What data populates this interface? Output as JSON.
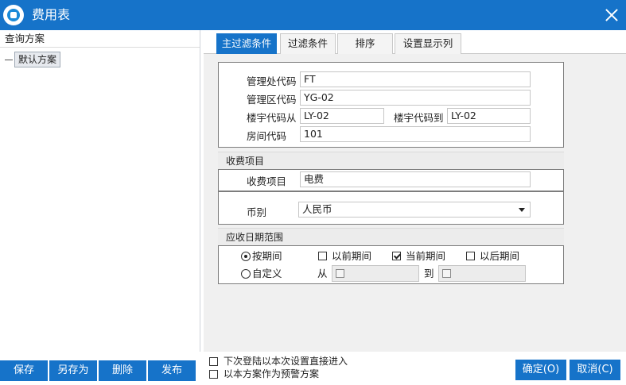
{
  "window": {
    "title": "费用表",
    "logo_icon": "app-logo-icon",
    "close_icon": "close-icon"
  },
  "left_panel": {
    "header": "查询方案",
    "schemes": [
      {
        "label": "默认方案",
        "selected": true
      }
    ]
  },
  "tabs": [
    {
      "label": "主过滤条件",
      "active": true
    },
    {
      "label": "过滤条件",
      "active": false
    },
    {
      "label": "排序",
      "active": false
    },
    {
      "label": "设置显示列",
      "active": false
    }
  ],
  "main_filter": {
    "mgmt_office_code": {
      "label": "管理处代码",
      "value": "FT"
    },
    "mgmt_area_code": {
      "label": "管理区代码",
      "value": "YG-02"
    },
    "building_from": {
      "label": "楼宇代码从",
      "value": "LY-02"
    },
    "building_to": {
      "label": "楼宇代码到",
      "value": "LY-02"
    },
    "room_code": {
      "label": "房间代码",
      "value": "101"
    }
  },
  "charge_section": {
    "header": "收费项目",
    "label": "收费项目",
    "value": "电费"
  },
  "currency": {
    "label": "币别",
    "value": "人民币"
  },
  "date_range": {
    "header": "应收日期范围",
    "by_period": {
      "label": "按期间",
      "selected": true
    },
    "previous_period": {
      "label": "以前期间",
      "checked": false
    },
    "current_period": {
      "label": "当前期间",
      "checked": true
    },
    "later_period": {
      "label": "以后期间",
      "checked": false
    },
    "custom": {
      "label": "自定义",
      "selected": false
    },
    "from_label": "从",
    "to_label": "到"
  },
  "footer": {
    "buttons": {
      "save": "保存",
      "save_as": "另存为",
      "delete": "删除",
      "publish": "发布",
      "ok": "确定(O)",
      "cancel": "取消(C)"
    },
    "options": [
      {
        "label": "下次登陆以本次设置直接进入",
        "checked": false
      },
      {
        "label": "以本方案作为预警方案",
        "checked": false
      }
    ]
  },
  "colors": {
    "accent": "#1673c9",
    "panel_bg": "#f0f0f0",
    "section_header_bg": "#ececec"
  }
}
